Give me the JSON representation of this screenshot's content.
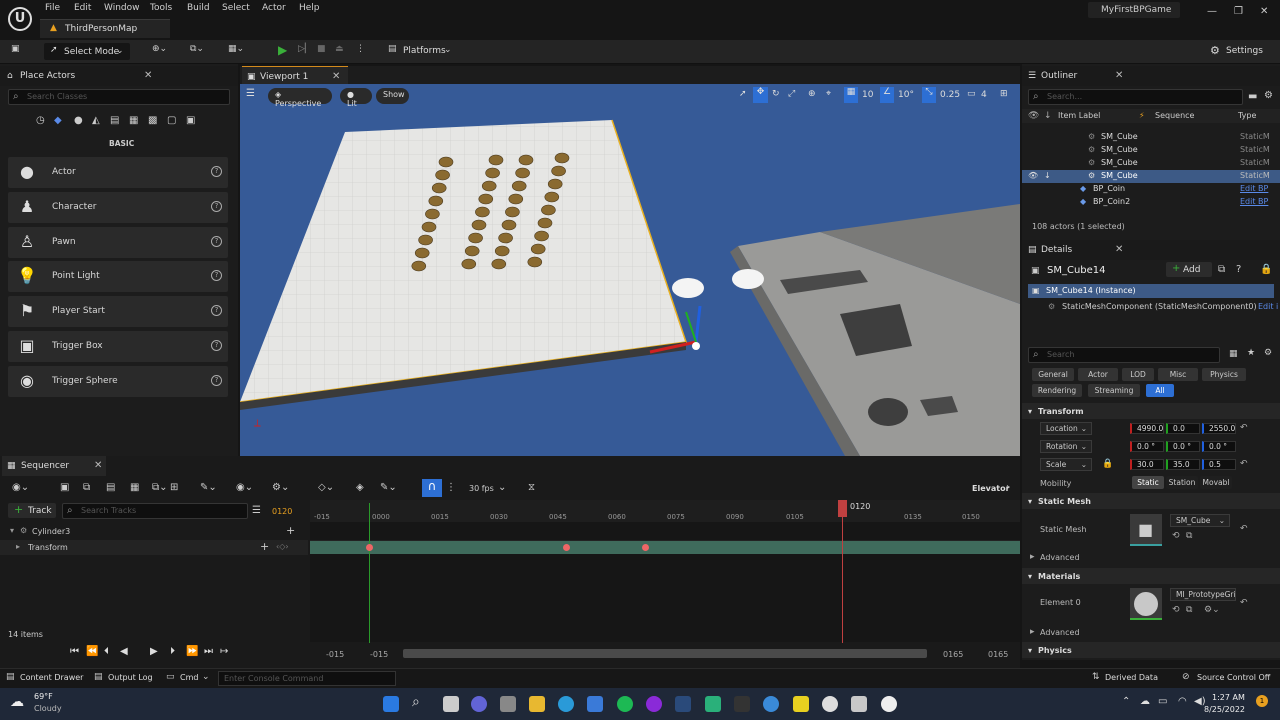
{
  "app": {
    "menus": [
      "File",
      "Edit",
      "Window",
      "Tools",
      "Build",
      "Select",
      "Actor",
      "Help"
    ],
    "map_tab": "ThirdPersonMap",
    "project": "MyFirstBPGame"
  },
  "toolbar": {
    "select_mode": "Select Mode",
    "platforms": "Platforms",
    "settings": "Settings"
  },
  "place_actors": {
    "tab": "Place Actors",
    "search_placeholder": "Search Classes",
    "category": "BASIC",
    "items": [
      "Actor",
      "Character",
      "Pawn",
      "Point Light",
      "Player Start",
      "Trigger Box",
      "Trigger Sphere"
    ]
  },
  "viewport": {
    "tab": "Viewport 1",
    "perspective": "Perspective",
    "lit": "Lit",
    "show": "Show",
    "grid_snap": "10",
    "rot_snap": "10°",
    "scale_snap": "0.25",
    "cam_speed": "4"
  },
  "outliner": {
    "tab": "Outliner",
    "search_placeholder": "Search...",
    "col_label": "Item Label",
    "col_sequence": "Sequence",
    "col_type": "Type",
    "rows": [
      {
        "name": "SM_Cube",
        "type": "StaticM"
      },
      {
        "name": "SM_Cube",
        "type": "StaticM"
      },
      {
        "name": "SM_Cube",
        "type": "StaticM"
      },
      {
        "name": "SM_Cube",
        "type": "StaticM"
      },
      {
        "name": "BP_Coin",
        "type": "Edit BP"
      },
      {
        "name": "BP_Coin2",
        "type": "Edit BP"
      }
    ],
    "count": "108 actors (1 selected)"
  },
  "details": {
    "tab": "Details",
    "actor_name": "SM_Cube14",
    "add": "Add",
    "instance": "SM_Cube14 (Instance)",
    "component": "StaticMeshComponent (StaticMeshComponent0)",
    "component_edit": "Edit i",
    "search_placeholder": "Search",
    "filters": [
      "General",
      "Actor",
      "LOD",
      "Misc",
      "Physics",
      "Rendering",
      "Streaming",
      "All"
    ],
    "transform": "Transform",
    "location": "Location",
    "rotation": "Rotation",
    "scale": "Scale",
    "loc": [
      "4990.0",
      "0.0",
      "2550.0"
    ],
    "rot": [
      "0.0 °",
      "0.0 °",
      "0.0 °"
    ],
    "scl": [
      "30.0",
      "35.0",
      "0.5"
    ],
    "mobility": "Mobility",
    "mobility_opts": [
      "Static",
      "Station",
      "Movabl"
    ],
    "static_mesh_section": "Static Mesh",
    "static_mesh_label": "Static Mesh",
    "static_mesh_value": "SM_Cube",
    "advanced": "Advanced",
    "materials": "Materials",
    "element0": "Element 0",
    "material_value": "MI_PrototypeGrid_",
    "physics": "Physics"
  },
  "sequencer": {
    "tab": "Sequencer",
    "fps": "30 fps",
    "seq_name": "Elevator",
    "add_track": "Track",
    "search_placeholder": "Search Tracks",
    "current_frame": "0120",
    "tracks": [
      "Cylinder3",
      "Transform"
    ],
    "ticks": [
      "-015",
      "0000",
      "0015",
      "0030",
      "0045",
      "0060",
      "0075",
      "0090",
      "0105",
      "0135",
      "0150"
    ],
    "playhead": "0120",
    "items_count": "14 items",
    "range_start_a": "-015",
    "range_start_b": "-015",
    "range_end_a": "0165",
    "range_end_b": "0165"
  },
  "status": {
    "content_drawer": "Content Drawer",
    "output_log": "Output Log",
    "cmd": "Cmd",
    "console_placeholder": "Enter Console Command",
    "derived_data": "Derived Data",
    "source_control": "Source Control Off"
  },
  "taskbar": {
    "temp": "69°F",
    "weather": "Cloudy",
    "time": "1:27 AM",
    "date": "8/25/2022"
  }
}
